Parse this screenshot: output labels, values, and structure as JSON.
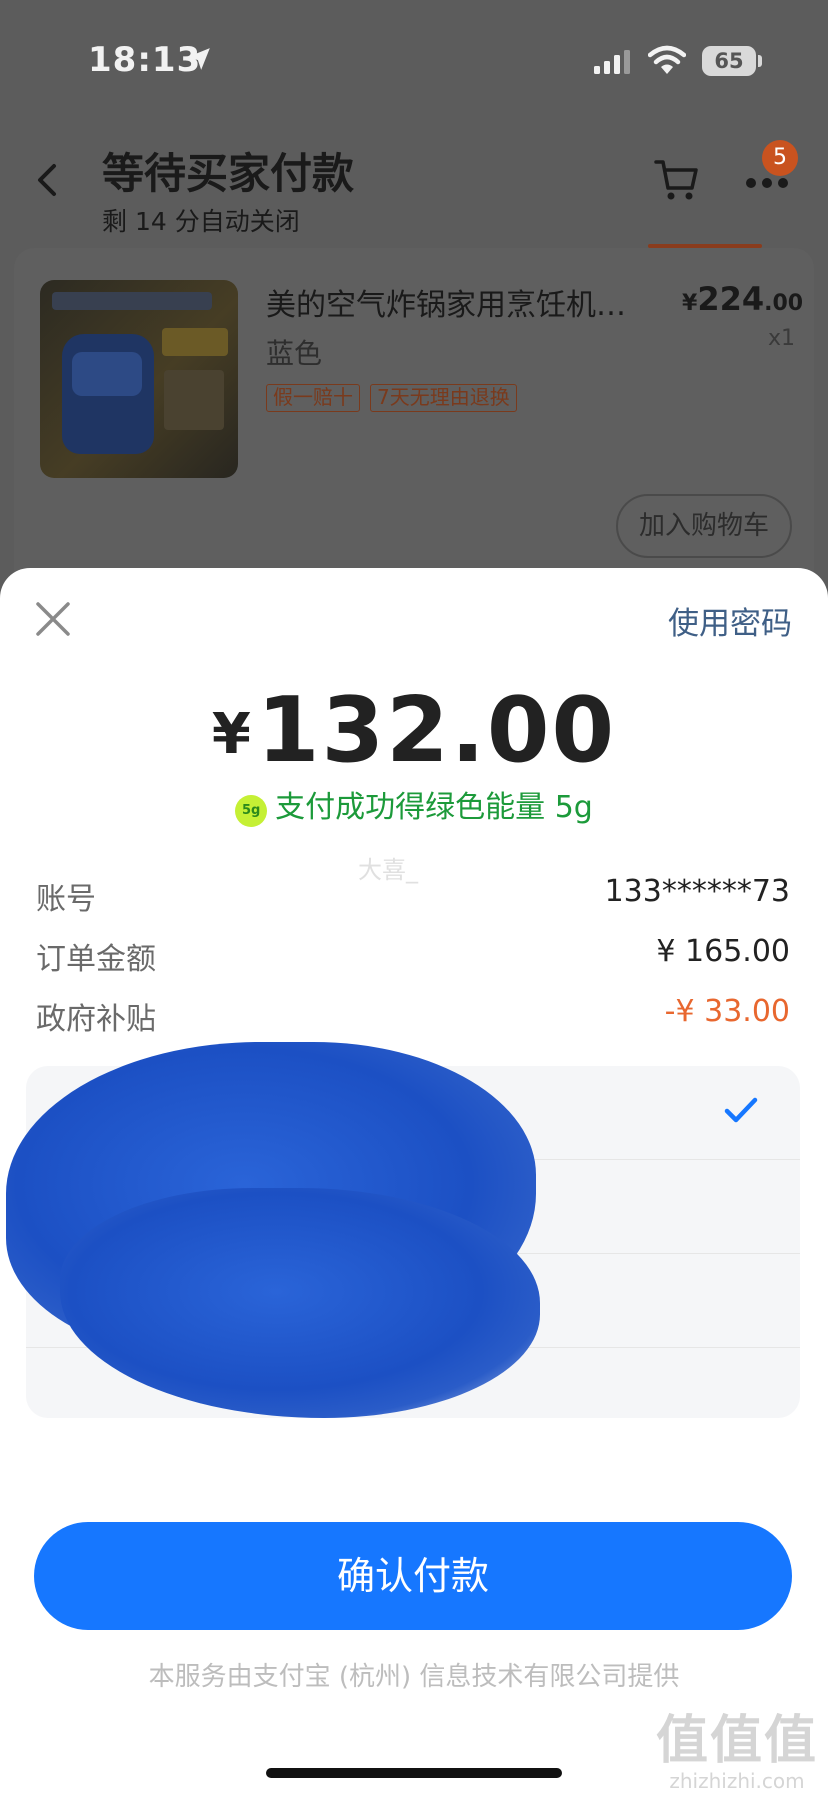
{
  "status_bar": {
    "time": "18:13",
    "battery": "65"
  },
  "nav": {
    "title": "等待买家付款",
    "subtitle": "剩 14 分自动关闭",
    "cart_badge": "5"
  },
  "product": {
    "name": "美的空气炸锅家用烹饪机…",
    "price_symbol": "¥",
    "price_int": "224",
    "price_dec": ".00",
    "color": "蓝色",
    "quantity": "x1",
    "tags": [
      "假一赔十",
      "7天无理由退换"
    ],
    "add_to_cart": "加入购物车"
  },
  "payment": {
    "use_password": "使用密码",
    "currency_symbol": "¥",
    "amount": "132.00",
    "energy_icon": "5g",
    "energy_text": "支付成功得绿色能量 5g",
    "faint_name": "大喜_",
    "rows": [
      {
        "label": "账号",
        "value": "133******73"
      },
      {
        "label": "订单金额",
        "value": "¥ 165.00"
      },
      {
        "label": "政府补贴",
        "value": "-¥ 33.00"
      }
    ],
    "confirm": "确认付款",
    "footer": "本服务由支付宝 (杭州) 信息技术有限公司提供"
  },
  "watermark": {
    "big": "值值值",
    "small": "zhizhizhi.com"
  },
  "colors": {
    "accent": "#1677ff",
    "discount": "#e8672f",
    "energy": "#1c9a3a",
    "link": "#3f5f86",
    "redaction": "#1c50c4"
  }
}
